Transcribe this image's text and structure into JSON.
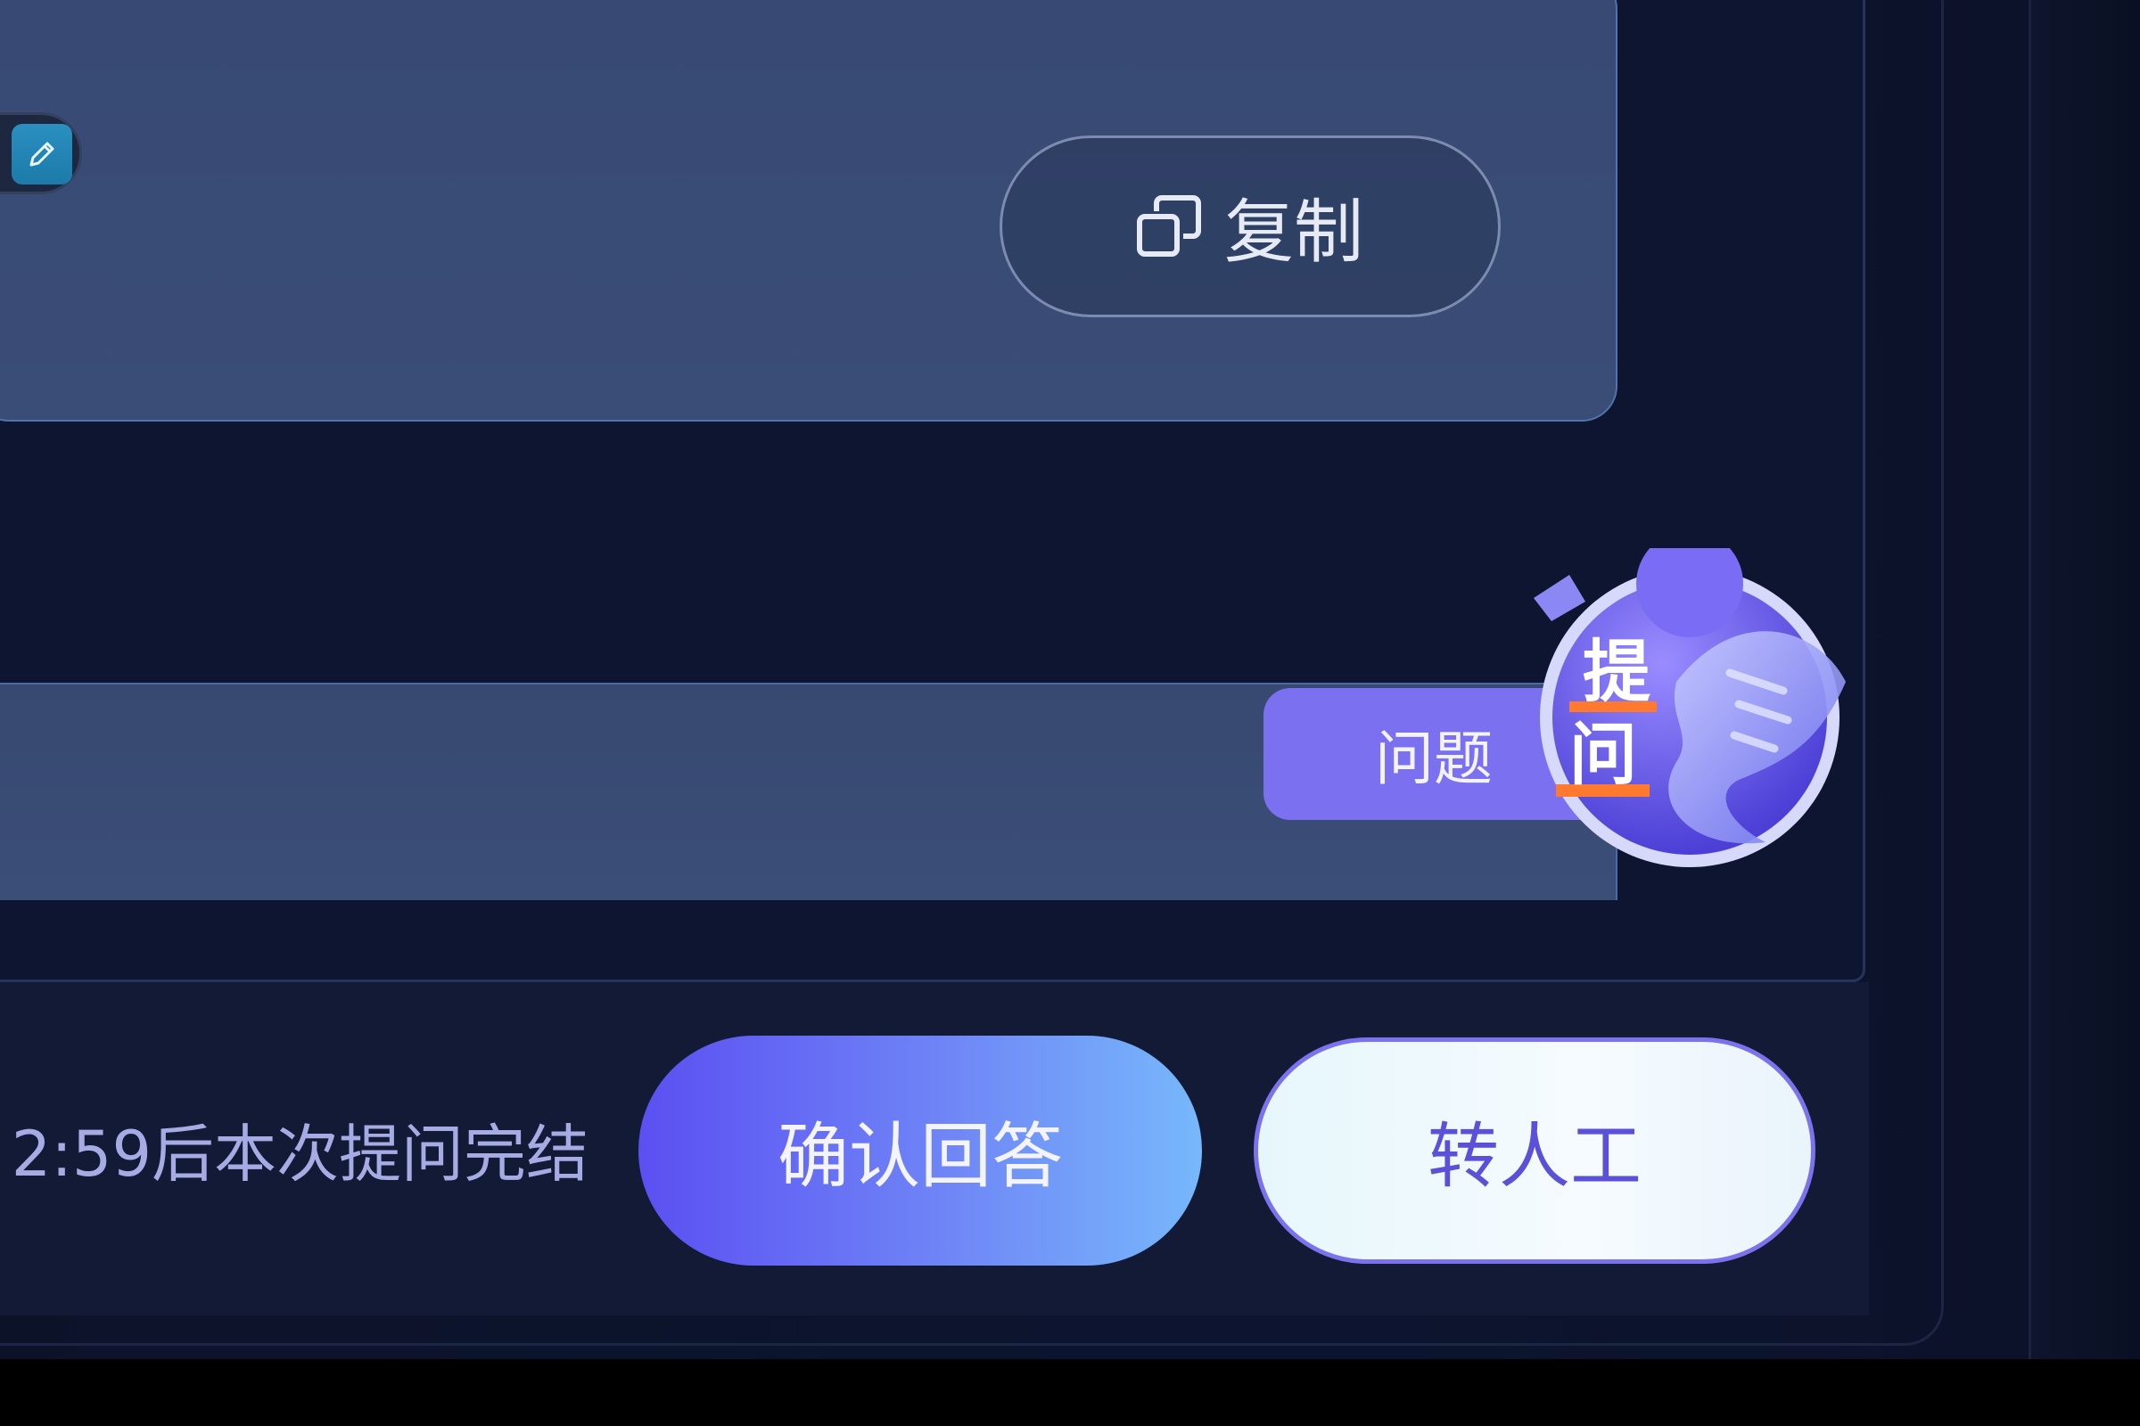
{
  "answer_card": {
    "copy_label": "复制",
    "copy_icon": "copy-icon",
    "edit_icon": "pen-icon"
  },
  "question_card": {
    "tag_label": "问题",
    "badge_text": [
      "提",
      "问"
    ]
  },
  "footer": {
    "countdown_text": "2:59后本次提问完结",
    "confirm_label": "确认回答",
    "human_label": "转人工"
  },
  "colors": {
    "accent_purple": "#7a70f0",
    "confirm_gradient_start": "#5b4ff2",
    "confirm_gradient_end": "#77b8fb",
    "human_text": "#5b50d8"
  }
}
